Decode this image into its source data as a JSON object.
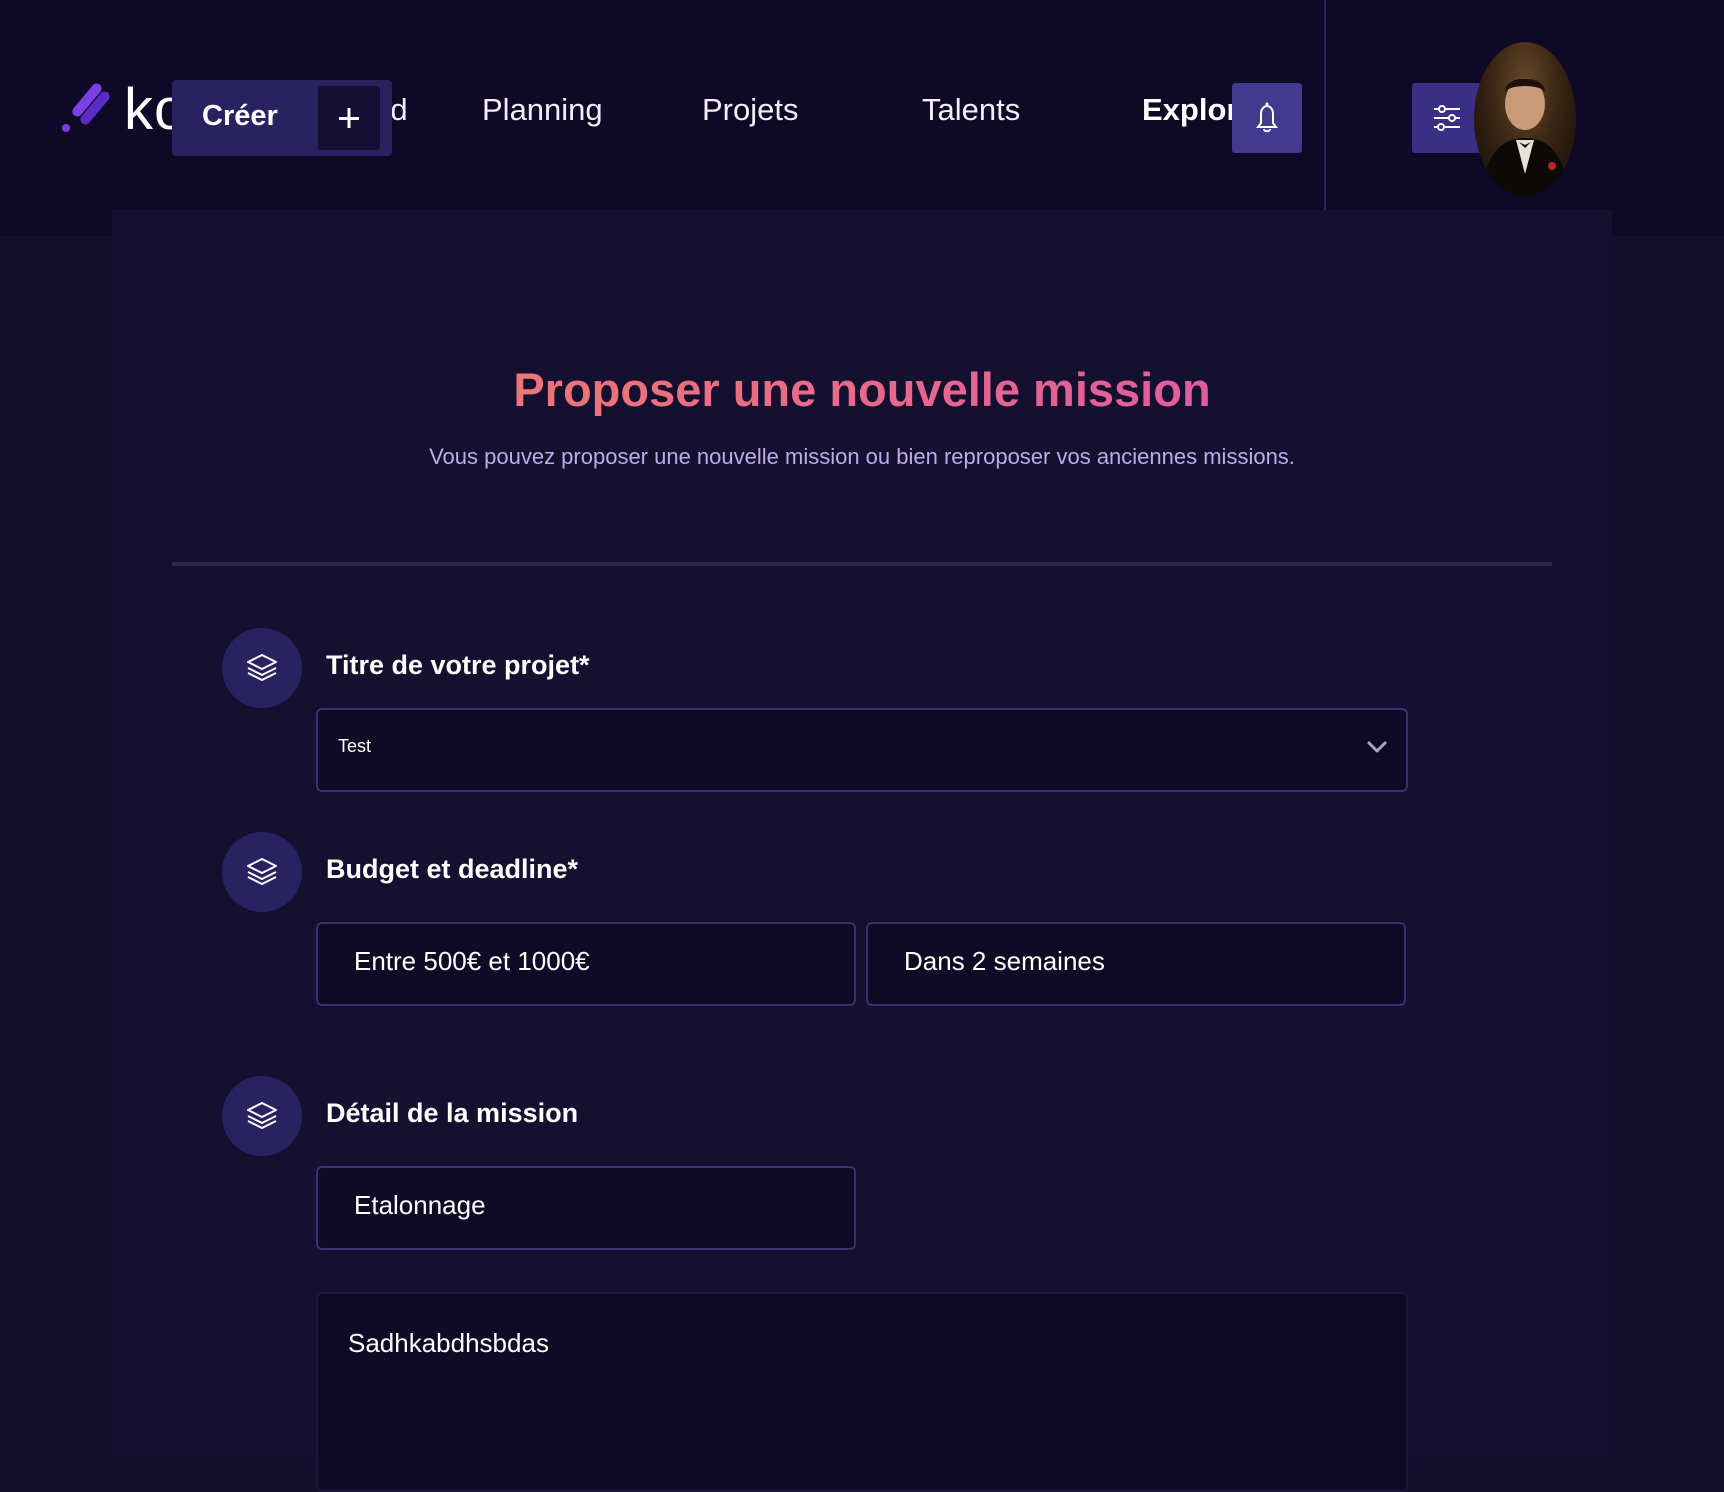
{
  "header": {
    "logo_text": "ko",
    "create_button": {
      "label": "Créer",
      "icon": "plus-icon"
    },
    "nav": [
      {
        "label": "rd",
        "active": false
      },
      {
        "label": "Planning",
        "active": false
      },
      {
        "label": "Projets",
        "active": false
      },
      {
        "label": "Talents",
        "active": false
      },
      {
        "label": "Explorer",
        "active": true
      }
    ],
    "notification_icon": "bell-icon",
    "settings_icon": "sliders-icon",
    "avatar_icon": "user-avatar"
  },
  "page": {
    "title": "Proposer une nouvelle mission",
    "subtitle": "Vous pouvez proposer une nouvelle mission ou bien reproposer vos anciennes missions."
  },
  "form": {
    "project": {
      "label": "Titre de votre projet*",
      "icon": "layers-icon",
      "selected_value": "Test"
    },
    "budget": {
      "label": "Budget et deadline*",
      "icon": "layers-icon",
      "budget_value": "Entre 500€ et 1000€",
      "deadline_value": "Dans 2 semaines"
    },
    "detail": {
      "label": "Détail de la mission",
      "icon": "layers-icon",
      "mission_type_value": "Etalonnage",
      "description_value": "Sadhkabdhsbdas"
    }
  },
  "colors": {
    "background": "#140f2d",
    "topbar": "#0e0926",
    "accent": "#433a8f",
    "title_gradient_start": "#ec7677",
    "title_gradient_end": "#e25c9e",
    "subtitle": "#b9aee8"
  }
}
